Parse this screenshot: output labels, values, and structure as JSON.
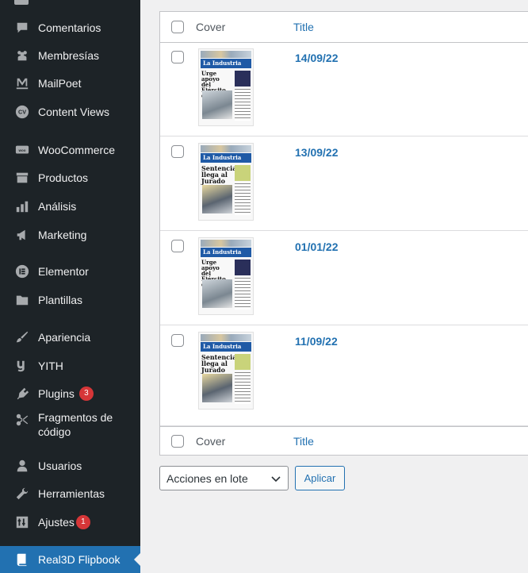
{
  "sidebar": {
    "items": [
      {
        "label": "Comentarios",
        "icon": "comment-icon"
      },
      {
        "label": "Membresías",
        "icon": "groups-icon"
      },
      {
        "label": "MailPoet",
        "icon": "mailpoet-icon"
      },
      {
        "label": "Content Views",
        "icon": "content-views-icon"
      },
      {
        "label": "WooCommerce",
        "icon": "woocommerce-icon"
      },
      {
        "label": "Productos",
        "icon": "archive-icon"
      },
      {
        "label": "Análisis",
        "icon": "chart-bar-icon"
      },
      {
        "label": "Marketing",
        "icon": "megaphone-icon"
      },
      {
        "label": "Elementor",
        "icon": "elementor-icon"
      },
      {
        "label": "Plantillas",
        "icon": "folder-icon"
      },
      {
        "label": "Apariencia",
        "icon": "paintbrush-icon"
      },
      {
        "label": "YITH",
        "icon": "yith-icon"
      },
      {
        "label": "Plugins",
        "icon": "plugin-icon",
        "badge": "3"
      },
      {
        "label": "Fragmentos de\ncódigo",
        "icon": "scissors-icon"
      },
      {
        "label": "Usuarios",
        "icon": "user-icon"
      },
      {
        "label": "Herramientas",
        "icon": "wrench-icon"
      },
      {
        "label": "Ajustes",
        "icon": "settings-icon",
        "badge": "1"
      },
      {
        "label": "Real3D Flipbook",
        "icon": "book-icon",
        "current": true
      }
    ],
    "badge_color": "#d63638",
    "current_color": "#2271b1",
    "background": "#1d2327"
  },
  "table": {
    "header": {
      "cover": "Cover",
      "title": "Title"
    },
    "footer": {
      "cover": "Cover",
      "title": "Title"
    },
    "rows": [
      {
        "title": "14/09/22",
        "cover": {
          "masthead": "La Industria",
          "headline": "Urge apoyo\ndel Ejército\nen playas"
        }
      },
      {
        "title": "13/09/22",
        "cover": {
          "masthead": "La Industria",
          "headline": "Sentencia\nllega al\nJurado"
        }
      },
      {
        "title": "01/01/22",
        "cover": {
          "masthead": "La Industria",
          "headline": "Urge apoyo\ndel Ejército\nen playas"
        }
      },
      {
        "title": "11/09/22",
        "cover": {
          "masthead": "La Industria",
          "headline": "Sentencia\nllega al\nJurado"
        }
      }
    ]
  },
  "bulk": {
    "select_value": "Acciones en lote",
    "apply_label": "Aplicar"
  },
  "colors": {
    "link": "#2271b1"
  }
}
